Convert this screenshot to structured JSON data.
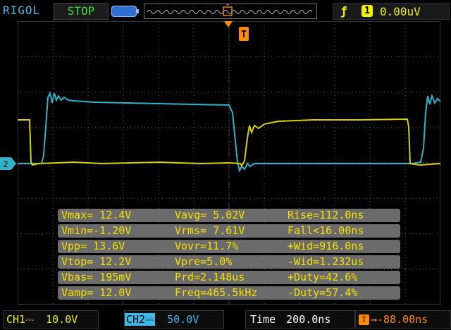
{
  "brand": "RIGOL",
  "status": "STOP",
  "trigger": {
    "edge_symbol": "ƒ",
    "source": "1",
    "level": "0.00uV",
    "marker": "T"
  },
  "ch2_marker": "2",
  "measurements": [
    [
      "Vmax= 12.4V",
      "Vavg= 5.02V",
      "Rise=112.0ns"
    ],
    [
      "Vmin=-1.20V",
      "Vrms= 7.61V",
      "Fall<16.00ns"
    ],
    [
      "Vpp= 13.6V",
      "Vovr=11.7%",
      "+Wid=916.0ns"
    ],
    [
      "Vtop= 12.2V",
      "Vpre=5.0%",
      "-Wid=1.232us"
    ],
    [
      "Vbas= 195mV",
      "Prd=2.148us",
      "+Duty=42.6%"
    ],
    [
      "Vamp= 12.0V",
      "Freq=465.5kHz",
      "-Duty=57.4%"
    ]
  ],
  "bottom": {
    "ch1_label": "CH1",
    "ch1_coupling": "⎓",
    "ch1_scale": "10.0V",
    "ch2_label": "CH2",
    "ch2_coupling": "⎓",
    "ch2_scale": "50.0V",
    "time_label": "Time",
    "time_value": "200.0ns",
    "offset_badge": "T",
    "offset_value": "→-88.00ns"
  },
  "colors": {
    "ch1": "#d8d000",
    "ch2": "#2eb3c8",
    "trigger": "#ff8a00",
    "grid": "#606060"
  }
}
